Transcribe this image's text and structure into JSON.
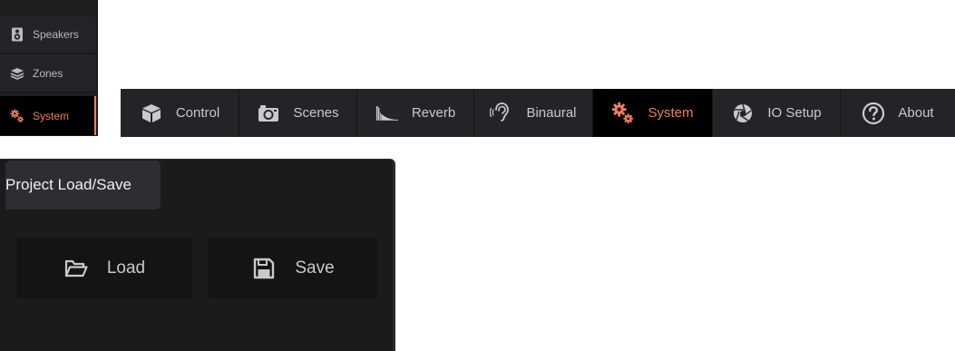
{
  "sidebar": {
    "items": [
      {
        "label": "Speakers",
        "icon": "speaker-icon",
        "active": false
      },
      {
        "label": "Zones",
        "icon": "layers-icon",
        "active": false
      },
      {
        "label": "System",
        "icon": "gears-icon",
        "active": true
      }
    ]
  },
  "tabs": [
    {
      "label": "Control",
      "icon": "cube-icon",
      "active": false
    },
    {
      "label": "Scenes",
      "icon": "camera-icon",
      "active": false
    },
    {
      "label": "Reverb",
      "icon": "reverb-decay-icon",
      "active": false
    },
    {
      "label": "Binaural",
      "icon": "ear-icon",
      "active": false
    },
    {
      "label": "System",
      "icon": "gears-icon",
      "active": true
    },
    {
      "label": "IO Setup",
      "icon": "aperture-icon",
      "active": false
    },
    {
      "label": "About",
      "icon": "help-icon",
      "active": false
    }
  ],
  "panel": {
    "title": "Project Load/Save",
    "load_label": "Load",
    "save_label": "Save"
  },
  "colors": {
    "accent": "#ef7d5b",
    "bar_bg": "#232427",
    "active_bg": "#000000",
    "panel_bg": "#1a1b1d"
  }
}
